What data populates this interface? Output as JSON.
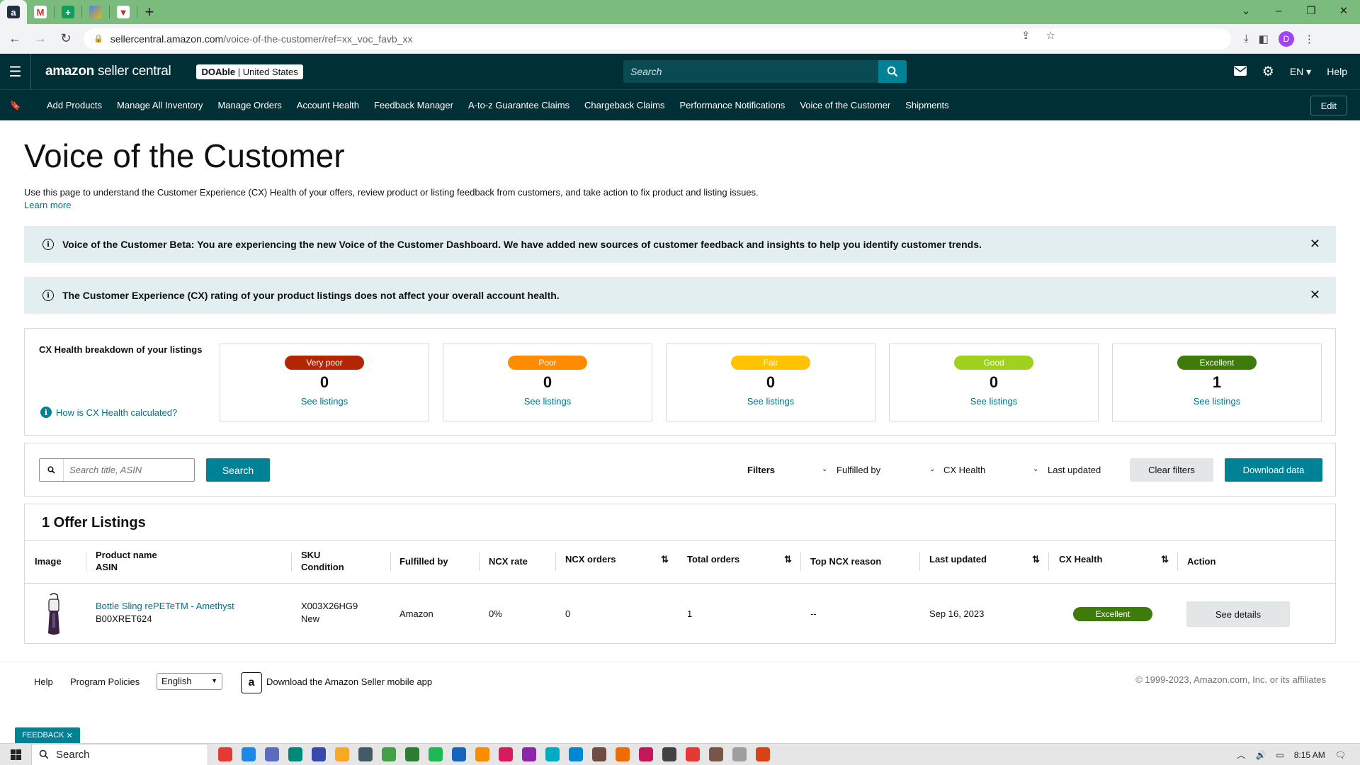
{
  "browser": {
    "tabs": [
      {
        "icon": "amazon-favicon",
        "letter": "a",
        "color": "#232f3e"
      },
      {
        "icon": "gmail-favicon",
        "letter": "M",
        "color": "#d93025"
      },
      {
        "icon": "sheets-favicon",
        "letter": "+",
        "color": "#0f9d58"
      },
      {
        "icon": "tab-favicon",
        "letter": "",
        "color": "#f4b400"
      },
      {
        "icon": "tab-favicon",
        "letter": "",
        "color": "#c62828"
      }
    ],
    "url_host": "sellercentral.amazon.com",
    "url_path": "/voice-of-the-customer/ref=xx_voc_favb_xx",
    "profile_initial": "D"
  },
  "header": {
    "logo_brand": "amazon",
    "logo_product": "seller central",
    "store_name": "DOAble",
    "store_region": "United States",
    "search_placeholder": "Search",
    "lang": "EN",
    "help": "Help"
  },
  "nav": {
    "items": [
      "Add Products",
      "Manage All Inventory",
      "Manage Orders",
      "Account Health",
      "Feedback Manager",
      "A-to-z Guarantee Claims",
      "Chargeback Claims",
      "Performance Notifications",
      "Voice of the Customer",
      "Shipments"
    ],
    "edit": "Edit"
  },
  "page": {
    "title": "Voice of the Customer",
    "description": "Use this page to understand the Customer Experience (CX) Health of your offers, review product or listing feedback from customers, and take action to fix product and listing issues.",
    "learn_more": "Learn more"
  },
  "alerts": [
    "Voice of the Customer Beta: You are experiencing the new Voice of the Customer Dashboard. We have added new sources of customer feedback and insights to help you identify customer trends.",
    "The Customer Experience (CX) rating of your product listings does not affect your overall account health."
  ],
  "cx_health": {
    "title": "CX Health breakdown of your listings",
    "how_link": "How is CX Health calculated?",
    "see_listings": "See listings",
    "cards": [
      {
        "label": "Very poor",
        "count": "0",
        "color": "#b12704"
      },
      {
        "label": "Poor",
        "count": "0",
        "color": "#ff8c00"
      },
      {
        "label": "Fair",
        "count": "0",
        "color": "#ffc300"
      },
      {
        "label": "Good",
        "count": "0",
        "color": "#9fd11e"
      },
      {
        "label": "Excellent",
        "count": "1",
        "color": "#3e7b0a"
      }
    ]
  },
  "filters": {
    "search_placeholder": "Search title, ASIN",
    "search_button": "Search",
    "filters_label": "Filters",
    "fulfilled_by": "Fulfilled by",
    "cx_health": "CX Health",
    "last_updated": "Last updated",
    "clear": "Clear filters",
    "download": "Download data"
  },
  "listings": {
    "title": "1 Offer Listings",
    "columns": {
      "image": "Image",
      "product_name": "Product name",
      "asin": "ASIN",
      "sku": "SKU",
      "condition": "Condition",
      "fulfilled_by": "Fulfilled by",
      "ncx_rate": "NCX rate",
      "ncx_orders": "NCX orders",
      "total_orders": "Total orders",
      "top_ncx_reason": "Top NCX reason",
      "last_updated": "Last updated",
      "cx_health": "CX Health",
      "action": "Action"
    },
    "rows": [
      {
        "product_name": "Bottle Sling rePETeTM - Amethyst",
        "asin": "B00XRET624",
        "sku": "X003X26HG9",
        "condition": "New",
        "fulfilled_by": "Amazon",
        "ncx_rate": "0%",
        "ncx_orders": "0",
        "total_orders": "1",
        "top_ncx_reason": "--",
        "last_updated": "Sep 16, 2023",
        "cx_health": "Excellent",
        "action": "See details"
      }
    ]
  },
  "footer": {
    "help": "Help",
    "program_policies": "Program Policies",
    "language": "English",
    "app_text": "Download the Amazon Seller mobile app",
    "copyright": "© 1999-2023, Amazon.com, Inc. or its affiliates"
  },
  "feedback_tab": "FEEDBACK",
  "taskbar": {
    "search": "Search",
    "time": "8:15 AM",
    "icon_colors": [
      "#e53935",
      "#1e88e5",
      "#5c6bc0",
      "#00897b",
      "#3949ab",
      "#f9a825",
      "#455a64",
      "#43a047",
      "#2e7d32",
      "#1db954",
      "#1565c0",
      "#fb8c00",
      "#d81b60",
      "#8e24aa",
      "#00acc1",
      "#0288d1",
      "#6d4c41",
      "#ef6c00",
      "#c2185b",
      "#424242",
      "#e53935",
      "#795548",
      "#9e9e9e",
      "#d84315"
    ]
  }
}
